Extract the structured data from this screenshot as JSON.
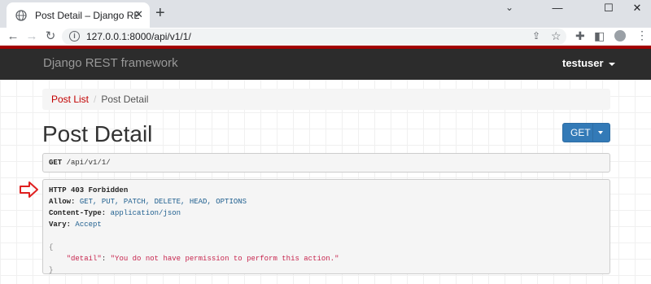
{
  "browser": {
    "tab_title": "Post Detail – Django REST framework",
    "url": "127.0.0.1:8000/api/v1/1/"
  },
  "navbar": {
    "brand": "Django REST framework",
    "user": "testuser"
  },
  "breadcrumb": {
    "items": [
      "Post List",
      "Post Detail"
    ]
  },
  "page": {
    "title": "Post Detail",
    "method_button": "GET",
    "request_method": "GET",
    "request_path": "/api/v1/1/"
  },
  "response": {
    "status": "HTTP 403 Forbidden",
    "allow_key": "Allow:",
    "allow_val": "GET, PUT, PATCH, DELETE, HEAD, OPTIONS",
    "ctype_key": "Content-Type:",
    "ctype_val": "application/json",
    "vary_key": "Vary:",
    "vary_val": "Accept",
    "open_brace": "{",
    "detail_key": "\"detail\"",
    "detail_val": "\"You do not have permission to perform this action.\"",
    "close_brace": "}"
  },
  "colors": {
    "navbar_bg": "#2c2c2c",
    "navbar_accent": "#a30000",
    "link": "#c20000",
    "button": "#337ab7",
    "annotation_arrow": "#e02020"
  }
}
